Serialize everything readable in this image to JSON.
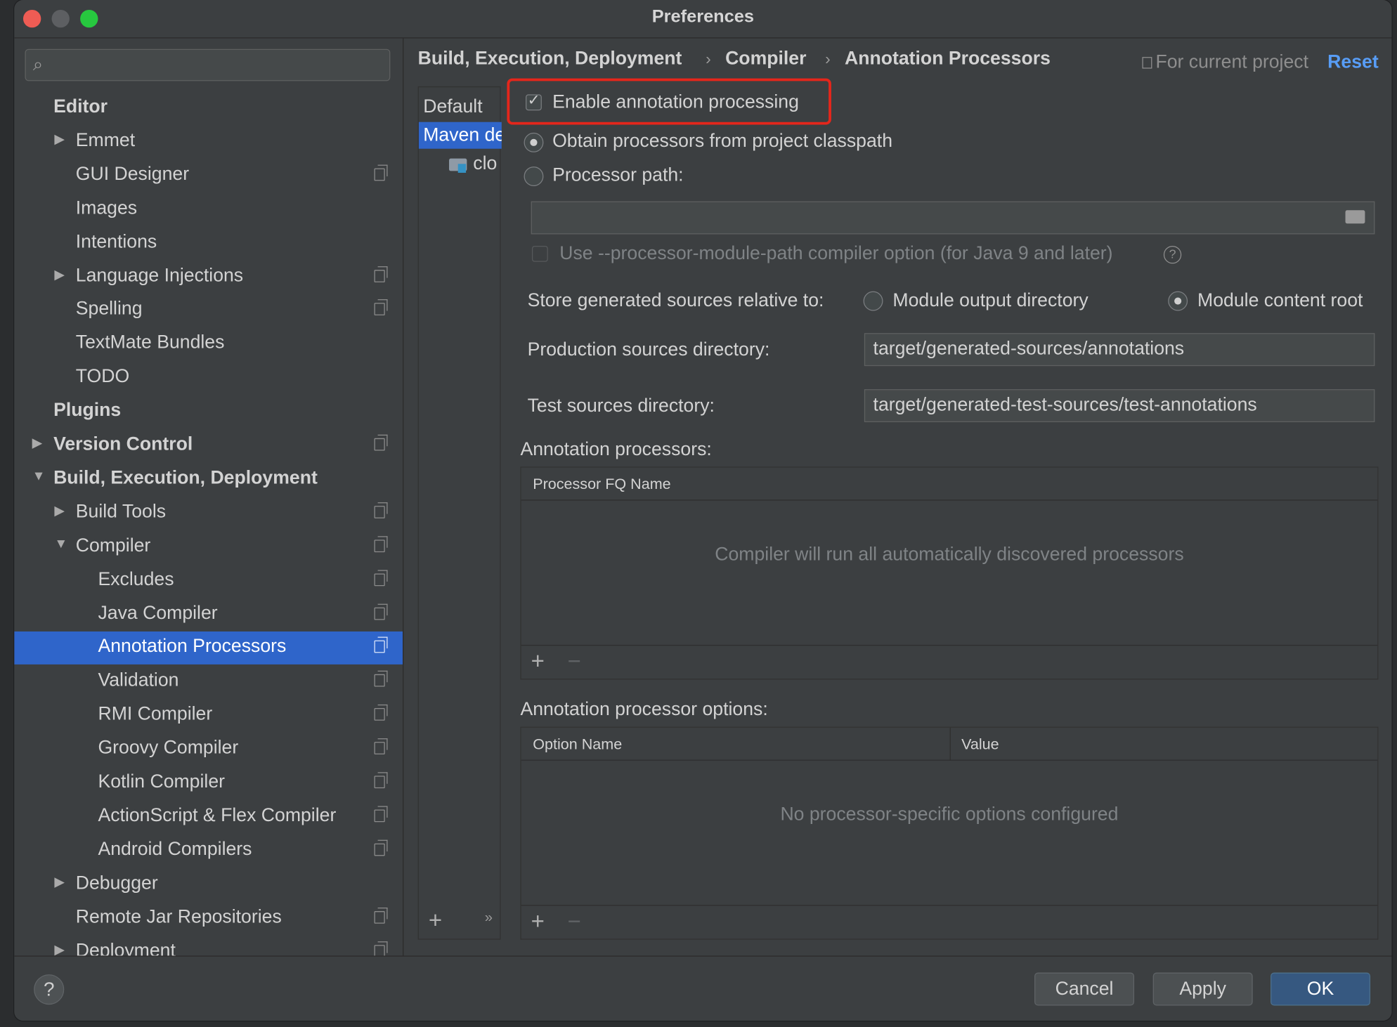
{
  "window": {
    "title": "Preferences"
  },
  "search": {
    "placeholder": ""
  },
  "sidebar": {
    "items": [
      {
        "label": "Editor"
      },
      {
        "label": "Emmet"
      },
      {
        "label": "GUI Designer"
      },
      {
        "label": "Images"
      },
      {
        "label": "Intentions"
      },
      {
        "label": "Language Injections"
      },
      {
        "label": "Spelling"
      },
      {
        "label": "TextMate Bundles"
      },
      {
        "label": "TODO"
      },
      {
        "label": "Plugins"
      },
      {
        "label": "Version Control"
      },
      {
        "label": "Build, Execution, Deployment"
      },
      {
        "label": "Build Tools"
      },
      {
        "label": "Compiler"
      },
      {
        "label": "Excludes"
      },
      {
        "label": "Java Compiler"
      },
      {
        "label": "Annotation Processors"
      },
      {
        "label": "Validation"
      },
      {
        "label": "RMI Compiler"
      },
      {
        "label": "Groovy Compiler"
      },
      {
        "label": "Kotlin Compiler"
      },
      {
        "label": "ActionScript & Flex Compiler"
      },
      {
        "label": "Android Compilers"
      },
      {
        "label": "Debugger"
      },
      {
        "label": "Remote Jar Repositories"
      },
      {
        "label": "Deployment"
      }
    ],
    "selected": "Annotation Processors"
  },
  "breadcrumb": {
    "items": [
      "Build, Execution, Deployment",
      "Compiler",
      "Annotation Processors"
    ],
    "separator": "›",
    "scope": "For current project",
    "reset": "Reset"
  },
  "profiles": {
    "items": [
      "Default",
      "Maven de",
      "clo"
    ],
    "selected": "Maven de",
    "add": "+",
    "more": "»"
  },
  "settings": {
    "enable_label": "Enable annotation processing",
    "enable_checked": true,
    "obtain_label": "Obtain processors from project classpath",
    "path_label": "Processor path:",
    "path_value": "",
    "module_path_label": "Use --processor-module-path compiler option (for Java 9 and later)",
    "help_glyph": "?",
    "store_label": "Store generated sources relative to:",
    "store_options": [
      "Module output directory",
      "Module content root"
    ],
    "store_selected": "Module content root",
    "prod_label": "Production sources directory:",
    "prod_value": "target/generated-sources/annotations",
    "test_label": "Test sources directory:",
    "test_value": "target/generated-test-sources/test-annotations"
  },
  "processors_table": {
    "title": "Annotation processors:",
    "column": "Processor FQ Name",
    "empty_text": "Compiler will run all automatically discovered processors",
    "add": "+",
    "remove": "−"
  },
  "options_table": {
    "title": "Annotation processor options:",
    "columns": [
      "Option Name",
      "Value"
    ],
    "empty_text": "No processor-specific options configured",
    "add": "+",
    "remove": "−"
  },
  "buttons": {
    "help": "?",
    "cancel": "Cancel",
    "apply": "Apply",
    "ok": "OK"
  },
  "colors": {
    "selection": "#2f65ca",
    "link": "#589df6",
    "highlight_box": "#e5261b"
  }
}
